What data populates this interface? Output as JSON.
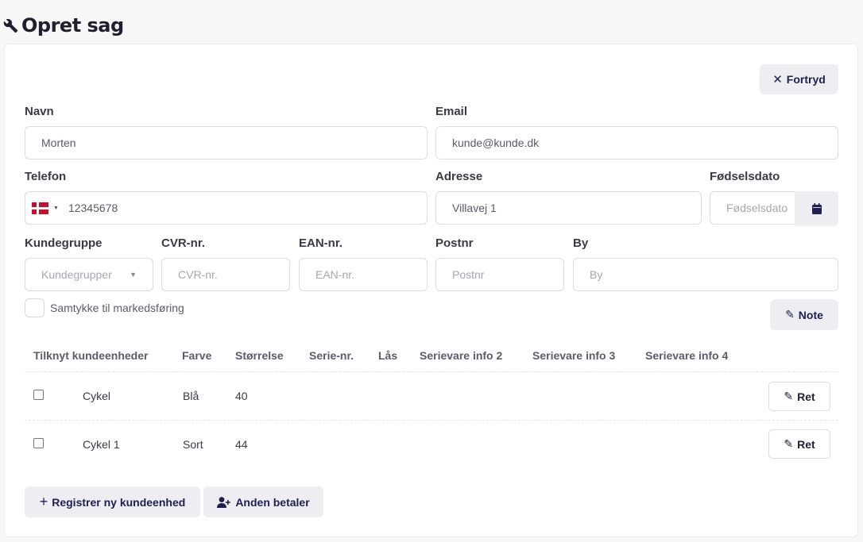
{
  "page": {
    "title": "Opret sag"
  },
  "actions": {
    "cancel_label": "Fortryd",
    "note_label": "Note"
  },
  "form": {
    "name": {
      "label": "Navn",
      "value": "Morten"
    },
    "email": {
      "label": "Email",
      "value": "kunde@kunde.dk"
    },
    "phone": {
      "label": "Telefon",
      "value": "12345678",
      "country": "DK"
    },
    "address": {
      "label": "Adresse",
      "value": "Villavej 1"
    },
    "birthdate": {
      "label": "Fødselsdato",
      "placeholder": "Fødselsdato"
    },
    "customer_group": {
      "label": "Kundegruppe",
      "placeholder": "Kundegrupper"
    },
    "cvr": {
      "label": "CVR-nr.",
      "placeholder": "CVR-nr."
    },
    "ean": {
      "label": "EAN-nr.",
      "placeholder": "EAN-nr."
    },
    "postal": {
      "label": "Postnr",
      "placeholder": "Postnr"
    },
    "city": {
      "label": "By",
      "placeholder": "By"
    },
    "marketing_consent": {
      "label": "Samtykke til markedsføring",
      "checked": false
    }
  },
  "table": {
    "headers": [
      "Tilknyt kundeenheder",
      "Farve",
      "Størrelse",
      "Serie-nr.",
      "Lås",
      "Serievare info 2",
      "Serievare info 3",
      "Serievare info 4"
    ],
    "rows": [
      {
        "name": "Cykel",
        "color": "Blå",
        "size": "40",
        "edit_label": "Ret",
        "checked": false
      },
      {
        "name": "Cykel 1",
        "color": "Sort",
        "size": "44",
        "edit_label": "Ret",
        "checked": false
      }
    ]
  },
  "footer": {
    "register_label": "Registrer ny kundeenhed",
    "other_payer_label": "Anden betaler"
  },
  "colors": {
    "accent": "#202050",
    "button_bg": "#eeeef2",
    "flag_red": "#c8102e"
  }
}
